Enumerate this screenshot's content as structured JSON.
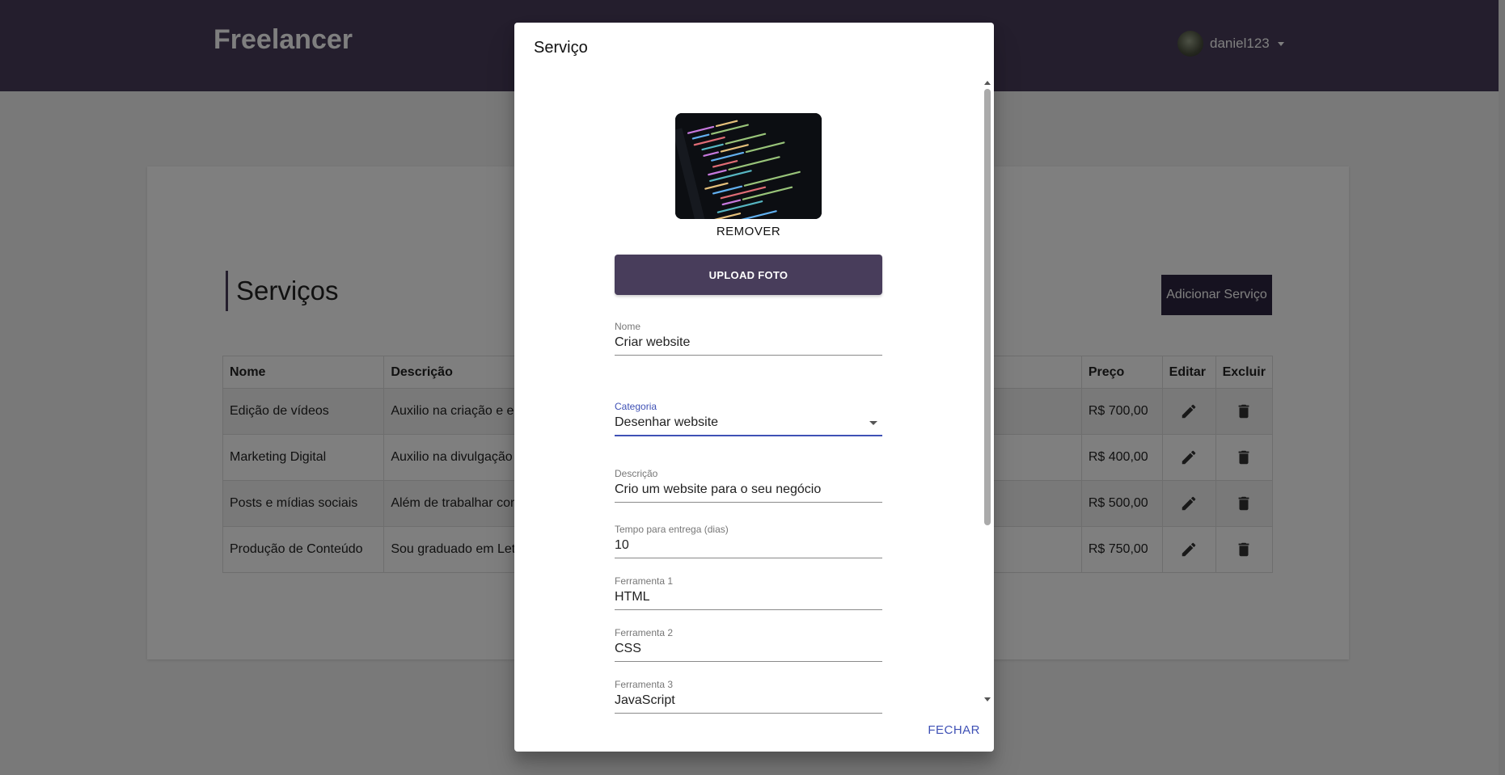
{
  "app": {
    "brand": "Freelancer"
  },
  "user": {
    "name": "daniel123"
  },
  "page": {
    "title": "Serviços",
    "add_button": "Adicionar Serviço"
  },
  "table": {
    "headers": {
      "nome": "Nome",
      "descricao": "Descrição",
      "preco": "Preço",
      "editar": "Editar",
      "excluir": "Excluir"
    },
    "rows": [
      {
        "nome": "Edição de vídeos",
        "descricao": "Auxilio na criação e edi",
        "preco": "R$ 700,00"
      },
      {
        "nome": "Marketing Digital",
        "descricao": "Auxilio na divulgação e",
        "preco": "R$ 400,00"
      },
      {
        "nome": "Posts e mídias sociais",
        "descricao": "Além de trabalhar com",
        "preco": "R$ 500,00"
      },
      {
        "nome": "Produção de Conteúdo",
        "descricao": "Sou graduado em Letra",
        "preco": "R$ 750,00"
      }
    ]
  },
  "dialog": {
    "title": "Serviço",
    "remover": "REMOVER",
    "upload": "UPLOAD FOTO",
    "fields": {
      "nome": {
        "label": "Nome",
        "value": "Criar website"
      },
      "categoria": {
        "label": "Categoria",
        "value": "Desenhar website"
      },
      "descricao": {
        "label": "Descrição",
        "value": "Crio um website para o seu negócio"
      },
      "tempo": {
        "label": "Tempo para entrega (dias)",
        "value": "10"
      },
      "ferramenta1": {
        "label": "Ferramenta 1",
        "value": "HTML"
      },
      "ferramenta2": {
        "label": "Ferramenta 2",
        "value": "CSS"
      },
      "ferramenta3": {
        "label": "Ferramenta 3",
        "value": "JavaScript"
      }
    },
    "close": "FECHAR"
  },
  "colors": {
    "primary": "#483d5b",
    "accent": "#3f51b5",
    "button_dark": "#2d2440"
  },
  "icons": {
    "edit": "pencil-icon",
    "delete": "trash-icon"
  }
}
